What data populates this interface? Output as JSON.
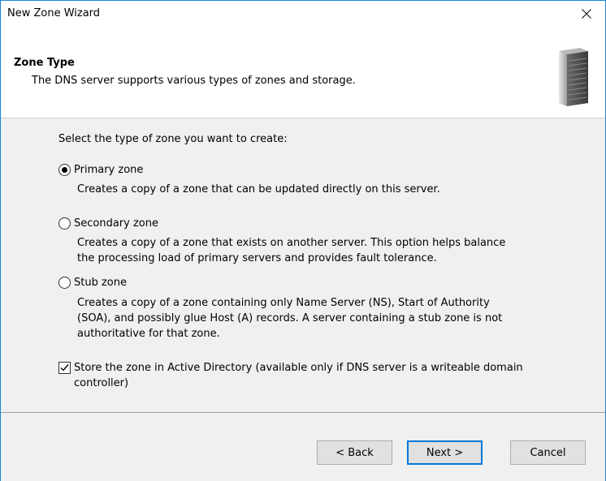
{
  "window": {
    "title": "New Zone Wizard",
    "close_icon": "close-icon"
  },
  "header": {
    "title": "Zone Type",
    "subtitle": "The DNS server supports various types of zones and storage.",
    "icon": "server-icon"
  },
  "main": {
    "prompt": "Select the type of zone you want to create:",
    "options": [
      {
        "label": "Primary zone",
        "selected": true,
        "description": [
          "Creates a copy of a zone that can be updated directly on this server."
        ]
      },
      {
        "label": "Secondary zone",
        "selected": false,
        "description": [
          "Creates a copy of a zone that exists on another server. This option helps balance",
          "the processing load of primary servers and provides fault tolerance."
        ]
      },
      {
        "label": "Stub zone",
        "selected": false,
        "description": [
          "Creates a copy of a zone containing only Name Server (NS), Start of Authority",
          "(SOA), and possibly glue Host (A) records. A server containing a stub zone is not",
          "authoritative for that zone."
        ]
      }
    ],
    "store_ad": {
      "checked": true,
      "label_lines": [
        "Store the zone in Active Directory (available only if DNS server is a writeable domain",
        "controller)"
      ]
    }
  },
  "footer": {
    "back_label": "< Back",
    "next_label": "Next >",
    "cancel_label": "Cancel"
  },
  "colors": {
    "accent": "#0078d7",
    "window_border": "#1883d7",
    "dialog_bg": "#f0f0f0"
  }
}
